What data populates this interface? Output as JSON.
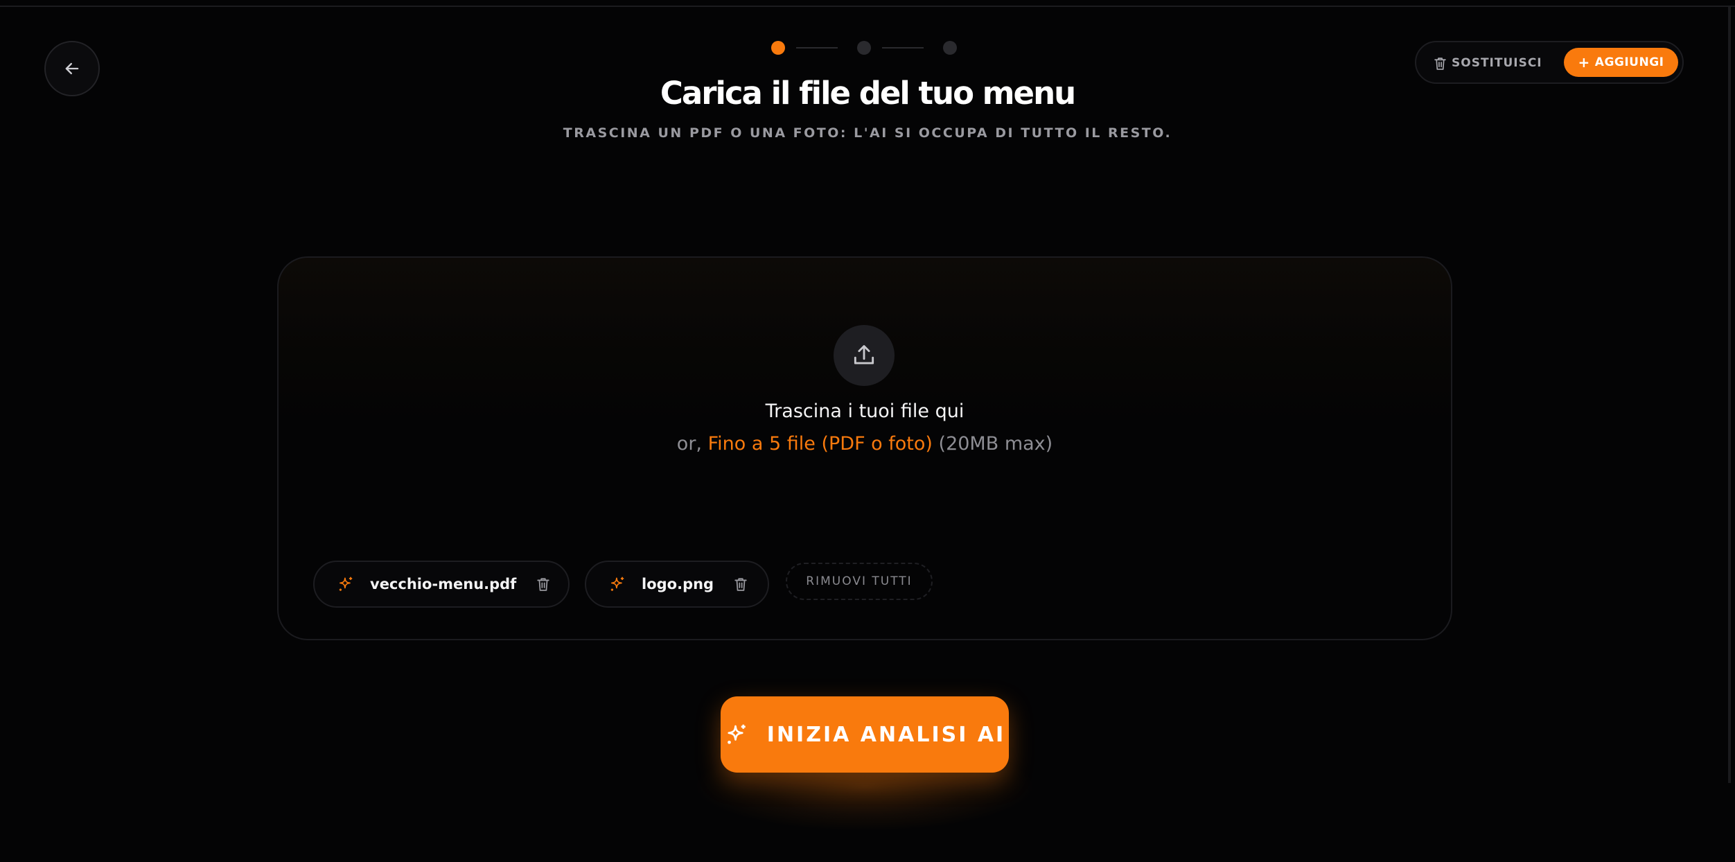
{
  "steps": {
    "count": 3,
    "active_index": 0
  },
  "header": {
    "title": "Carica il file del tuo menu",
    "subtitle": "TRASCINA UN PDF O UNA FOTO: L'AI SI OCCUPA DI TUTTO IL RESTO."
  },
  "actions": {
    "replace_label": "SOSTITUISCI",
    "add_label": "AGGIUNGI"
  },
  "dropzone": {
    "title": "Trascina i tuoi file qui",
    "hint_prefix": "or,",
    "hint_accent": "Fino a 5 file (PDF o foto)",
    "hint_suffix": "(20MB max)"
  },
  "files": [
    {
      "name": "vecchio-menu.pdf"
    },
    {
      "name": "logo.png"
    }
  ],
  "remove_all_label": "RIMUOVI TUTTI",
  "cta": {
    "label": "INIZIA ANALISI AI"
  },
  "colors": {
    "accent": "#f97a0d",
    "background": "#040405"
  },
  "icons": {
    "back": "arrow-left-icon",
    "replace": "trash-icon",
    "add": "plus-icon",
    "upload": "upload-icon",
    "file": "sparkles-icon",
    "remove": "trash-icon",
    "cta": "sparkles-icon"
  }
}
